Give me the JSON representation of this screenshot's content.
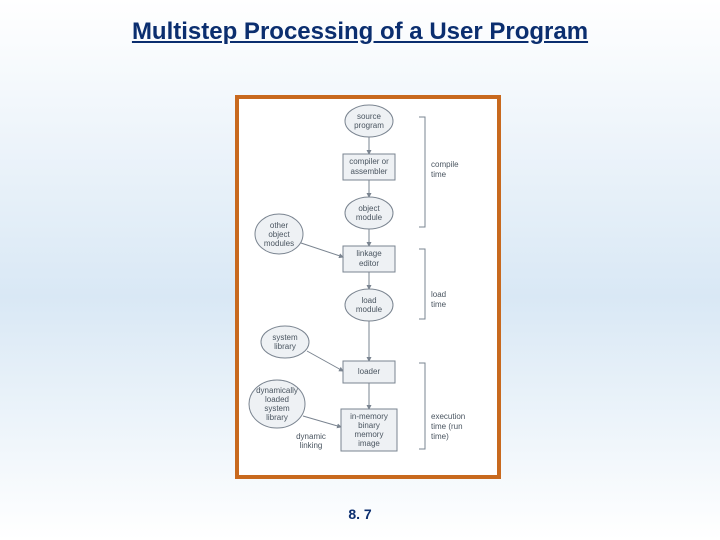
{
  "title": "Multistep Processing of a User Program",
  "footer": "8. 7",
  "nodes": {
    "source_program": {
      "l1": "source",
      "l2": "program"
    },
    "compiler": {
      "l1": "compiler or",
      "l2": "assembler"
    },
    "object_module": {
      "l1": "object",
      "l2": "module"
    },
    "linkage_editor": {
      "l1": "linkage",
      "l2": "editor"
    },
    "load_module": {
      "l1": "load",
      "l2": "module"
    },
    "loader": {
      "l1": "loader",
      "l2": ""
    },
    "memory_image": {
      "l1": "in-memory",
      "l2": "binary",
      "l3": "memory",
      "l4": "image"
    },
    "other_obj": {
      "l1": "other",
      "l2": "object",
      "l3": "modules"
    },
    "system_library": {
      "l1": "system",
      "l2": "library"
    },
    "dyn_library": {
      "l1": "dynamically",
      "l2": "loaded",
      "l3": "system",
      "l4": "library"
    },
    "dynamic_linking": {
      "l1": "dynamic",
      "l2": "linking"
    }
  },
  "phases": {
    "compile": {
      "l1": "compile",
      "l2": "time"
    },
    "load": {
      "l1": "load",
      "l2": "time"
    },
    "exec": {
      "l1": "execution",
      "l2": "time (run",
      "l3": "time)"
    }
  }
}
